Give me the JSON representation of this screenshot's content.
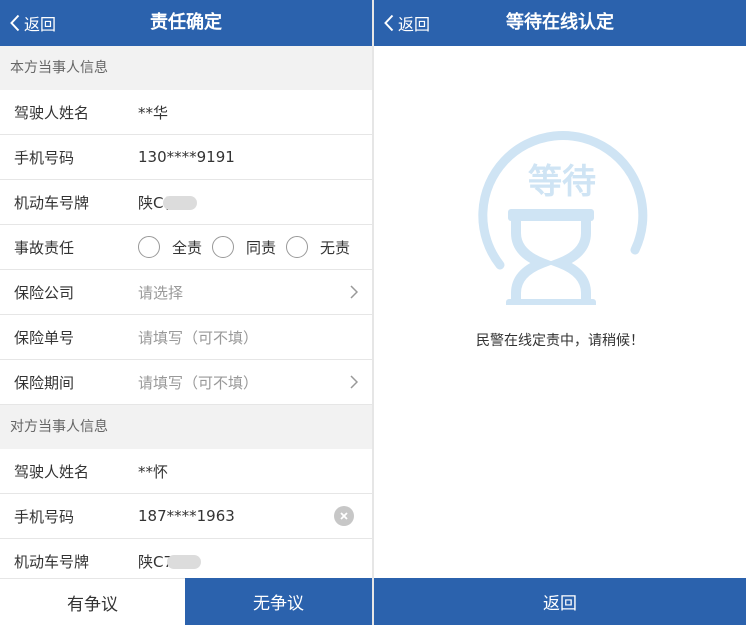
{
  "colors": {
    "primary": "#2b62ad",
    "section_bg": "#f2f2f2",
    "graphic": "#cfe4f4"
  },
  "left": {
    "nav": {
      "back_label": "返回",
      "title": "责任确定"
    },
    "own_section": "本方当事人信息",
    "own": {
      "driver": {
        "label": "驾驶人姓名",
        "value": "**华"
      },
      "phone": {
        "label": "手机号码",
        "value": "130****9191"
      },
      "plate": {
        "label": "机动车号牌",
        "value": "陕C("
      },
      "responsibility": {
        "label": "事故责任",
        "options": [
          "全责",
          "同责",
          "无责"
        ]
      },
      "insurer": {
        "label": "保险公司",
        "placeholder": "请选择"
      },
      "policy_no": {
        "label": "保险单号",
        "placeholder": "请填写（可不填）"
      },
      "period": {
        "label": "保险期间",
        "placeholder": "请填写（可不填）"
      }
    },
    "other_section": "对方当事人信息",
    "other": {
      "driver": {
        "label": "驾驶人姓名",
        "value": "**怀"
      },
      "phone": {
        "label": "手机号码",
        "value": "187****1963"
      },
      "plate": {
        "label": "机动车号牌",
        "value": "陕C7"
      }
    },
    "buttons": {
      "dispute": "有争议",
      "no_dispute": "无争议"
    }
  },
  "right": {
    "nav": {
      "back_label": "返回",
      "title": "等待在线认定"
    },
    "graphic_text": "等待",
    "message": "民警在线定责中，请稍候！",
    "back_button": "返回"
  }
}
